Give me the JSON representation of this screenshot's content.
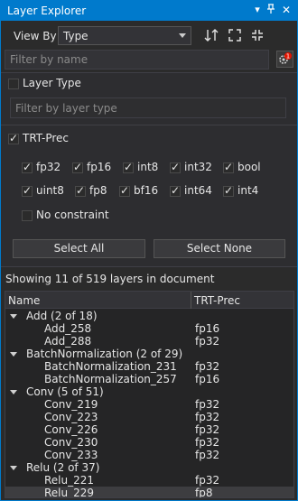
{
  "window": {
    "title": "Layer Explorer"
  },
  "toolbar": {
    "view_by_label": "View By",
    "view_by_value": "Type"
  },
  "search": {
    "placeholder": "Filter by name"
  },
  "layer_type": {
    "label": "Layer Type",
    "checked": false,
    "placeholder": "Filter by layer type"
  },
  "trt_prec": {
    "label": "TRT-Prec",
    "checked": true,
    "options": [
      {
        "label": "fp32",
        "checked": true
      },
      {
        "label": "fp16",
        "checked": true
      },
      {
        "label": "int8",
        "checked": true
      },
      {
        "label": "int32",
        "checked": true
      },
      {
        "label": "bool",
        "checked": true
      },
      {
        "label": "uint8",
        "checked": true
      },
      {
        "label": "fp8",
        "checked": true
      },
      {
        "label": "bf16",
        "checked": true
      },
      {
        "label": "int64",
        "checked": true
      },
      {
        "label": "int4",
        "checked": true
      }
    ],
    "no_constraint": {
      "label": "No constraint",
      "checked": false
    },
    "select_all_label": "Select All",
    "select_none_label": "Select None"
  },
  "status_text": "Showing 11 of 519 layers in document",
  "table": {
    "columns": [
      "Name",
      "TRT-Prec"
    ],
    "rows": [
      {
        "kind": "group",
        "name": "Add (2 of 18)",
        "prec": ""
      },
      {
        "kind": "item",
        "name": "Add_258",
        "prec": "fp16"
      },
      {
        "kind": "item",
        "name": "Add_288",
        "prec": "fp32"
      },
      {
        "kind": "group",
        "name": "BatchNormalization (2 of 29)",
        "prec": ""
      },
      {
        "kind": "item",
        "name": "BatchNormalization_231",
        "prec": "fp32"
      },
      {
        "kind": "item",
        "name": "BatchNormalization_257",
        "prec": "fp16"
      },
      {
        "kind": "group",
        "name": "Conv (5 of 51)",
        "prec": ""
      },
      {
        "kind": "item",
        "name": "Conv_219",
        "prec": "fp32"
      },
      {
        "kind": "item",
        "name": "Conv_223",
        "prec": "fp32"
      },
      {
        "kind": "item",
        "name": "Conv_226",
        "prec": "fp32"
      },
      {
        "kind": "item",
        "name": "Conv_230",
        "prec": "fp32"
      },
      {
        "kind": "item",
        "name": "Conv_233",
        "prec": "fp32"
      },
      {
        "kind": "group",
        "name": "Relu (2 of 37)",
        "prec": ""
      },
      {
        "kind": "item",
        "name": "Relu_221",
        "prec": "fp32"
      },
      {
        "kind": "item",
        "name": "Relu_229",
        "prec": "fp8",
        "selected": true
      }
    ]
  },
  "colors": {
    "accent": "#007acc",
    "badge": "#e51400"
  }
}
